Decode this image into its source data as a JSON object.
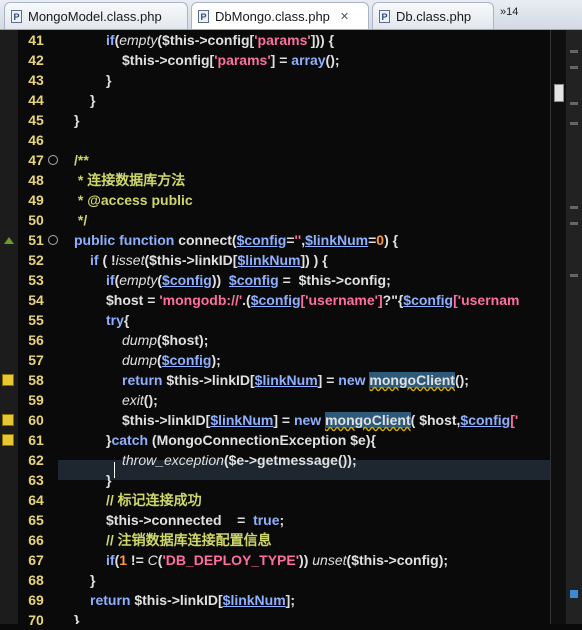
{
  "tabs": [
    {
      "label": "MongoModel.class.php",
      "icon": "php-file-icon",
      "active": false
    },
    {
      "label": "DbMongo.class.php",
      "icon": "php-file-icon",
      "active": true
    },
    {
      "label": "Db.class.php",
      "icon": "php-file-icon",
      "active": false
    }
  ],
  "tab_close": "✕",
  "overflow_label": "»14",
  "line_numbers": [
    "41",
    "42",
    "43",
    "44",
    "45",
    "46",
    "47",
    "48",
    "49",
    "50",
    "51",
    "52",
    "53",
    "54",
    "55",
    "56",
    "57",
    "58",
    "59",
    "60",
    "61",
    "62",
    "63",
    "64",
    "65",
    "66",
    "67",
    "68",
    "69",
    "70"
  ],
  "code": {
    "l41": {
      "kw": "if",
      "a": "(",
      "fn": "empty",
      "b": "(",
      "v": "$this",
      "c": "->config[",
      "s": "'params'",
      "d": "])) {"
    },
    "l42": {
      "v": "$this",
      "a": "->config[",
      "s": "'params'",
      "b": "] = ",
      "kw": "array",
      "c": "();"
    },
    "l43": {
      "a": "}"
    },
    "l44": {
      "a": "}"
    },
    "l45": {
      "a": "}"
    },
    "l46": {
      "a": ""
    },
    "l47": {
      "c": "/**"
    },
    "l48": {
      "c": " * 连接数据库方法"
    },
    "l49": {
      "c": " * @access public"
    },
    "l50": {
      "c": " */"
    },
    "l51": {
      "kw": "public function",
      "a": " connect(",
      "p1": "$config",
      "b": "=",
      "s": "''",
      "c": ",",
      "p2": "$linkNum",
      "d": "=",
      "n": "0",
      "e": ") {"
    },
    "l52": {
      "kw": "if",
      "a": " ( !",
      "fn": "isset",
      "b": "(",
      "v": "$this",
      "c": "->linkID[",
      "p": "$linkNum",
      "d": "]) ) {"
    },
    "l53": {
      "kw": "if",
      "a": "(",
      "fn": "empty",
      "b": "(",
      "p": "$config",
      "c": "))  ",
      "p2": "$config",
      "d": " =  ",
      "v": "$this",
      "e": "->config;"
    },
    "l54": {
      "v": "$host",
      "a": " = ",
      "s": "'mongodb://'",
      "b": ".(",
      "p": "$config",
      "s2": "['username']",
      "c": "?\"{",
      "p2": "$config",
      "s3": "['usernam"
    },
    "l55": {
      "kw": "try",
      "a": "{"
    },
    "l56": {
      "fn": "dump",
      "a": "(",
      "v": "$host",
      "b": ");"
    },
    "l57": {
      "fn": "dump",
      "a": "(",
      "p": "$config",
      "b": ");"
    },
    "l58": {
      "kw": "return",
      "a": " ",
      "v": "$this",
      "b": "->linkID[",
      "p": "$linkNum",
      "c": "] = ",
      "kw2": "new",
      "d": " ",
      "cls": "mongoClient",
      "e": "();"
    },
    "l59": {
      "fn": "exit",
      "a": "();"
    },
    "l60": {
      "v": "$this",
      "a": "->linkID[",
      "p": "$linkNum",
      "b": "] = ",
      "kw": "new",
      "c": " ",
      "cls": "mongoClient",
      "d": "( ",
      "v2": "$host",
      "e": ",",
      "p2": "$config",
      "f": "['"
    },
    "l61": {
      "a": "}",
      "kw": "catch",
      "b": " (MongoConnectionException ",
      "v": "$e",
      "c": "){"
    },
    "l62": {
      "fn": "throw_exception",
      "a": "(",
      "v": "$e",
      "b": "->getmessage());"
    },
    "l63": {
      "a": "}"
    },
    "l64": {
      "c": "// 标记连接成功"
    },
    "l65": {
      "v": "$this",
      "a": "->connected    =  ",
      "kw": "true",
      "b": ";"
    },
    "l66": {
      "c": "// 注销数据库连接配置信息"
    },
    "l67": {
      "kw": "if",
      "a": "(",
      "n": "1",
      "b": " != ",
      "fn": "C",
      "c": "(",
      "s": "'DB_DEPLOY_TYPE'",
      "d": ")) ",
      "fn2": "unset",
      "e": "(",
      "v": "$this",
      "f": "->config);"
    },
    "l68": {
      "a": "}"
    },
    "l69": {
      "kw": "return",
      "a": " ",
      "v": "$this",
      "b": "->linkID[",
      "p": "$linkNum",
      "c": "];"
    },
    "l70": {
      "a": "}"
    }
  }
}
